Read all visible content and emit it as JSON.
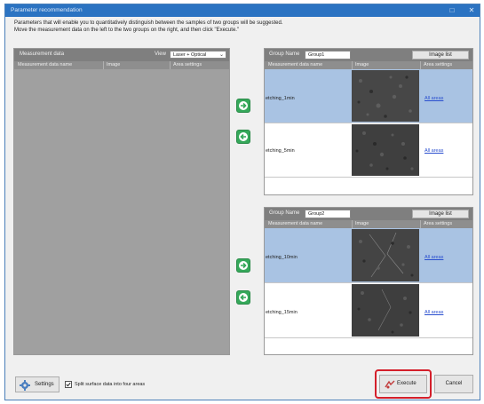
{
  "window": {
    "title": "Parameter recommendation",
    "minimize_glyph": "□",
    "close_glyph": "✕"
  },
  "instructions": {
    "line1": "Parameters that will enable you to quantitatively distinguish between the samples of two groups will be suggested.",
    "line2": "Move the measurement data on the left to the two groups on the right, and then click \"Execute.\""
  },
  "left_panel": {
    "title": "Measurement data",
    "view_label": "View",
    "view_value": "Laser + Optical",
    "columns": [
      "Measurement data name",
      "Image",
      "Area settings"
    ]
  },
  "group1": {
    "name_label": "Group Name",
    "name_value": "Group1",
    "image_list_label": "Image list",
    "columns": [
      "Measurement data name",
      "Image",
      "Area settings"
    ],
    "rows": [
      {
        "name": "etching_1min",
        "link": "All areas",
        "selected": true
      },
      {
        "name": "etching_5min",
        "link": "All areas",
        "selected": false
      }
    ]
  },
  "group2": {
    "name_label": "Group Name",
    "name_value": "Group2",
    "image_list_label": "Image list",
    "columns": [
      "Measurement data name",
      "Image",
      "Area settings"
    ],
    "rows": [
      {
        "name": "etching_10min",
        "link": "All areas",
        "selected": true
      },
      {
        "name": "etching_15min",
        "link": "All areas",
        "selected": false
      }
    ]
  },
  "bottom": {
    "settings_label": "Settings",
    "split_label": "Split surface data into four areas",
    "split_checked": true,
    "execute_label": "Execute",
    "cancel_label": "Cancel"
  },
  "icons": {
    "move_right": "arrow-right-icon",
    "move_left": "arrow-left-icon",
    "settings": "gear-icon",
    "execute": "execute-icon"
  },
  "colors": {
    "titlebar": "#2b73c2",
    "arrow_green": "#35a85a",
    "selected_row": "#a9c3e3",
    "highlight": "#d41f2b",
    "link": "#2a4fcf"
  }
}
